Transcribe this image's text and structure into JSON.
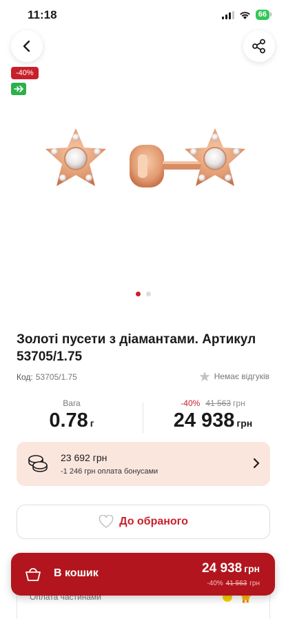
{
  "status_bar": {
    "time": "11:18",
    "battery": "66"
  },
  "badges": {
    "discount": "-40%"
  },
  "carousel": {
    "count": 2,
    "active": 0
  },
  "product": {
    "title": "Золоті пусети з діамантами. Артикул 53705/1.75",
    "code_label": "Код:",
    "code_value": "53705/1.75",
    "reviews": "Немає відгуків",
    "weight_label": "Вага",
    "weight_value": "0.78",
    "weight_unit": "г",
    "discount_pct": "-40%",
    "old_price": "41 563",
    "currency": "грн",
    "price": "24 938"
  },
  "bonus": {
    "amount": "23 692 грн",
    "subtitle": "-1 246 грн оплата бонусами"
  },
  "favorites": {
    "label": "До обраного"
  },
  "installment": {
    "label": "Оплата частинами"
  },
  "cart_bar": {
    "label": "В кошик",
    "price": "24 938",
    "currency": "грн",
    "discount_pct": "-40%",
    "old_price": "41 563",
    "old_currency": "грн"
  },
  "colors": {
    "accent": "#c8202a",
    "cart_bg": "#b2151d",
    "bonus_bg": "#fbe6de",
    "delivery_green": "#2bb14a"
  },
  "icons": {
    "back": "chevron-left-icon",
    "share": "share-icon",
    "delivery": "airplane-icon",
    "star": "star-icon",
    "coins": "coins-icon",
    "chevron": "chevron-right-icon",
    "heart": "heart-icon",
    "cart": "basket-icon"
  }
}
